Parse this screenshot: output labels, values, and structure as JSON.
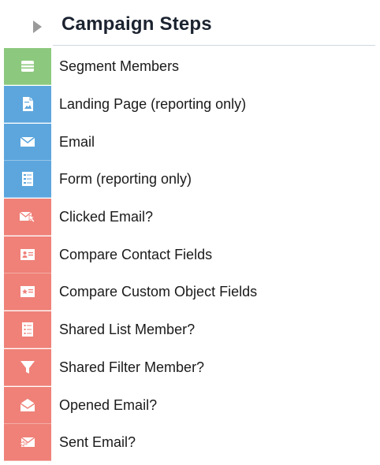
{
  "header": {
    "title": "Campaign Steps"
  },
  "colors": {
    "green": "#8cc97e",
    "blue": "#5ca6dd",
    "red": "#ef8178"
  },
  "steps": [
    {
      "label": "Segment Members",
      "icon": "segment-icon",
      "color": "#8cc97e"
    },
    {
      "label": "Landing Page (reporting only)",
      "icon": "landing-page-icon",
      "color": "#5ca6dd"
    },
    {
      "label": "Email",
      "icon": "email-icon",
      "color": "#5ca6dd"
    },
    {
      "label": "Form (reporting only)",
      "icon": "form-icon",
      "color": "#5ca6dd"
    },
    {
      "label": "Clicked Email?",
      "icon": "clicked-email-icon",
      "color": "#ef8178"
    },
    {
      "label": "Compare Contact Fields",
      "icon": "contact-card-icon",
      "color": "#ef8178"
    },
    {
      "label": "Compare Custom Object Fields",
      "icon": "custom-object-icon",
      "color": "#ef8178"
    },
    {
      "label": "Shared List Member?",
      "icon": "list-icon",
      "color": "#ef8178"
    },
    {
      "label": "Shared Filter Member?",
      "icon": "filter-icon",
      "color": "#ef8178"
    },
    {
      "label": "Opened Email?",
      "icon": "opened-email-icon",
      "color": "#ef8178"
    },
    {
      "label": "Sent Email?",
      "icon": "sent-email-icon",
      "color": "#ef8178"
    }
  ]
}
